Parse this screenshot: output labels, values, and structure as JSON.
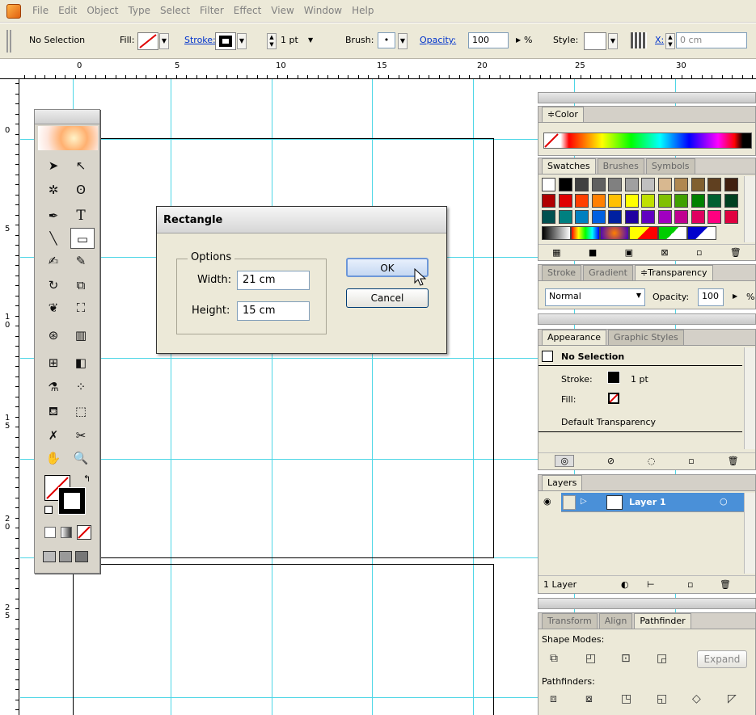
{
  "menubar": {
    "items": [
      "File",
      "Edit",
      "Object",
      "Type",
      "Select",
      "Filter",
      "Effect",
      "View",
      "Window",
      "Help"
    ]
  },
  "control_bar": {
    "selection_status": "No Selection",
    "fill_label": "Fill:",
    "stroke_label": "Stroke:",
    "stroke_weight": "1 pt",
    "brush_label": "Brush:",
    "brush_value": "•",
    "opacity_label": "Opacity:",
    "opacity_value": "100",
    "percent": "%",
    "style_label": "Style:",
    "x_label": "X:",
    "x_value": "0 cm"
  },
  "rulers": {
    "horizontal": [
      "0",
      "5",
      "10",
      "15",
      "20",
      "25",
      "30"
    ],
    "vertical": [
      "0",
      "5",
      "1\n0",
      "1\n5",
      "2\n0",
      "2\n5"
    ]
  },
  "dialog": {
    "title": "Rectangle",
    "options_label": "Options",
    "width_label": "Width:",
    "width_value": "21 cm",
    "height_label": "Height:",
    "height_value": "15 cm",
    "ok_label": "OK",
    "cancel_label": "Cancel"
  },
  "color_panel": {
    "tab": "≑Color"
  },
  "swatches_panel": {
    "tabs": [
      "Swatches",
      "Brushes",
      "Symbols"
    ],
    "colors": [
      [
        "#ffffff",
        "#000000",
        "#404040",
        "#606060",
        "#808080",
        "#a0a0a0",
        "#c0c0c0",
        "#d8b890",
        "#b08850",
        "#806030",
        "#604020",
        "#402010"
      ],
      [
        "#b00000",
        "#e00000",
        "#ff4000",
        "#ff8000",
        "#ffc000",
        "#ffff00",
        "#c0e000",
        "#80c000",
        "#40a000",
        "#008000",
        "#006030",
        "#004020"
      ],
      [
        "#005050",
        "#008080",
        "#0080c0",
        "#0060e0",
        "#0020a0",
        "#2000a0",
        "#6000c0",
        "#a000c0",
        "#c00090",
        "#e00060",
        "#ff0080",
        "#e00040"
      ]
    ]
  },
  "transparency_panel": {
    "tabs": [
      "Stroke",
      "Gradient",
      "≑Transparency"
    ],
    "blend_mode": "Normal",
    "opacity_label": "Opacity:",
    "opacity_value": "100",
    "percent": "%"
  },
  "appearance_panel": {
    "tabs": [
      "Appearance",
      "Graphic Styles"
    ],
    "title_row": "No Selection",
    "stroke_label": "Stroke:",
    "stroke_value": "1 pt",
    "fill_label": "Fill:",
    "transparency_row": "Default Transparency"
  },
  "layers_panel": {
    "tab": "Layers",
    "layer_name": "Layer 1",
    "footer_count": "1 Layer"
  },
  "pathfinder_panel": {
    "tabs": [
      "Transform",
      "Align",
      "Pathfinder"
    ],
    "shape_modes_label": "Shape Modes:",
    "expand_label": "Expand",
    "pathfinders_label": "Pathfinders:"
  }
}
